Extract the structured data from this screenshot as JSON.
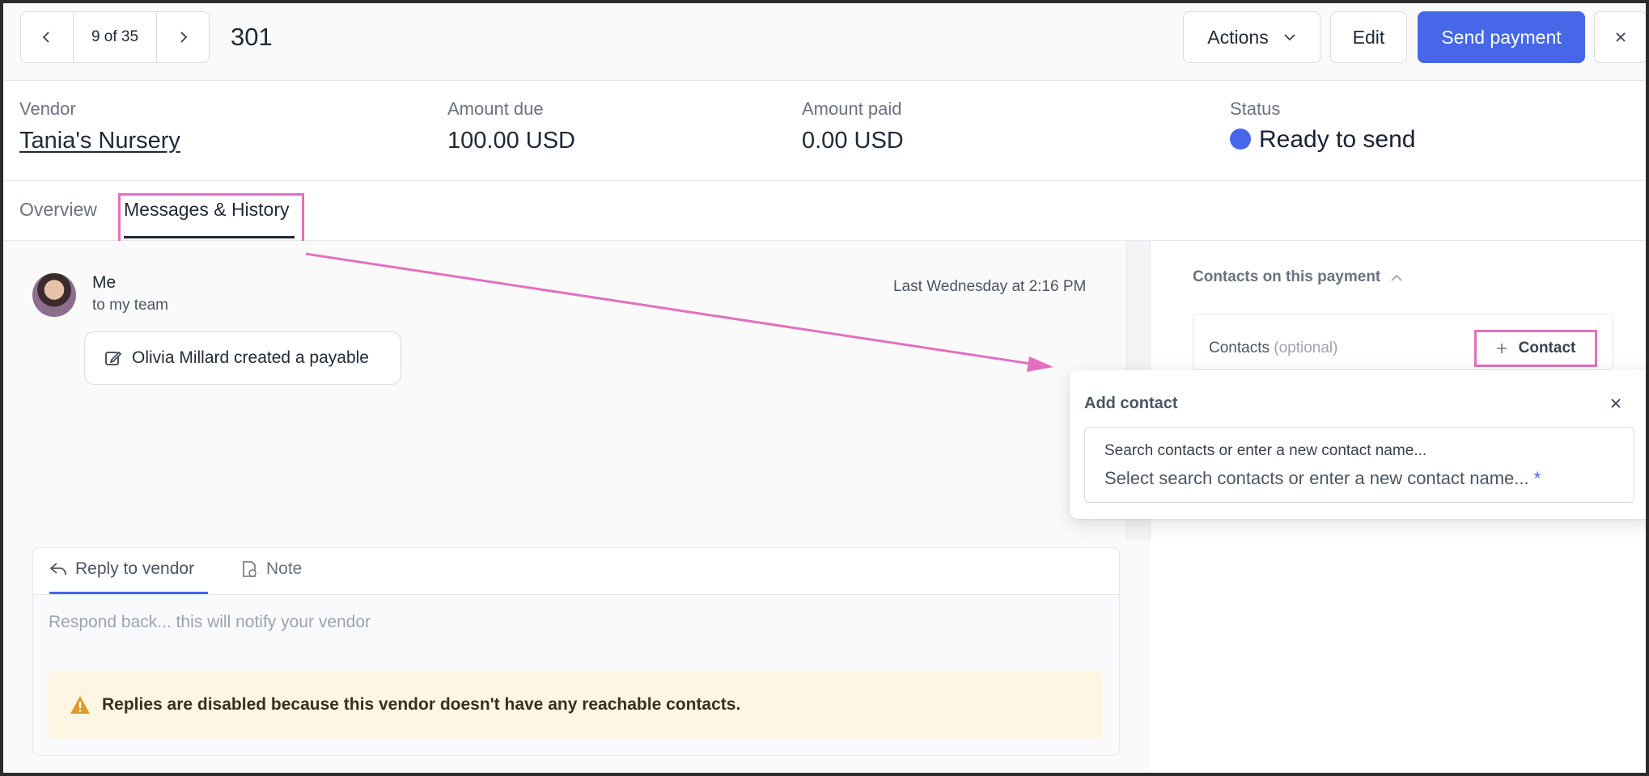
{
  "header": {
    "pager_count": "9 of 35",
    "document_number": "301",
    "actions_label": "Actions",
    "edit_label": "Edit",
    "send_label": "Send payment"
  },
  "summary": {
    "vendor_label": "Vendor",
    "vendor_name": "Tania's Nursery",
    "amount_due_label": "Amount due",
    "amount_due": "100.00 USD",
    "amount_paid_label": "Amount paid",
    "amount_paid": "0.00 USD",
    "status_label": "Status",
    "status_value": "Ready to send"
  },
  "tabs": {
    "overview": "Overview",
    "messages": "Messages & History"
  },
  "message": {
    "from": "Me",
    "to": "to my team",
    "time": "Last Wednesday at 2:16 PM",
    "event": "Olivia Millard created a payable"
  },
  "reply": {
    "tab_reply": "Reply to vendor",
    "tab_note": "Note",
    "placeholder": "Respond back... this will notify your vendor",
    "warning": "Replies are disabled because this vendor doesn't have any reachable contacts."
  },
  "contacts": {
    "heading": "Contacts on this payment",
    "label": "Contacts",
    "optional": "(optional)",
    "add_label": "Contact"
  },
  "popover": {
    "title": "Add contact",
    "field_label": "Search contacts or enter a new contact name...",
    "field_value": "Select search contacts or enter a new contact name...",
    "required_mark": "*"
  },
  "colors": {
    "primary": "#4667e8",
    "highlight": "#e36fc0",
    "warning_bg": "#fdf6e3",
    "warning_icon": "#e09b2d"
  }
}
